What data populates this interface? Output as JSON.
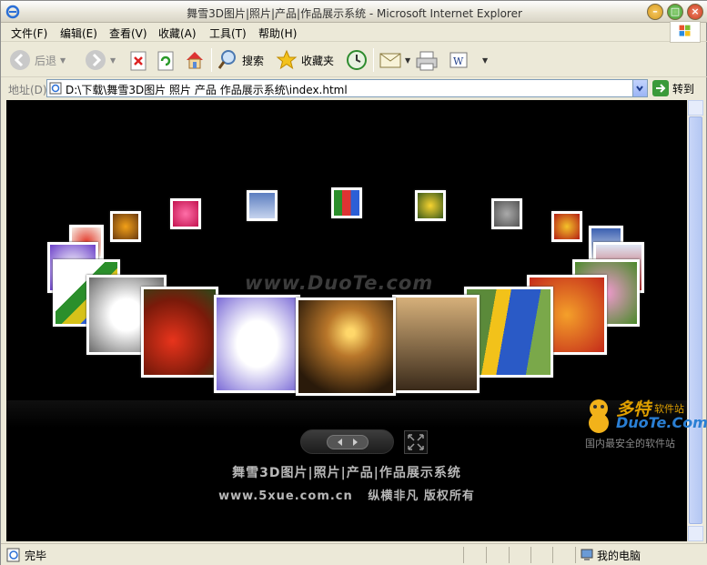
{
  "window": {
    "title": "舞雪3D图片|照片|产品|作品展示系统 - Microsoft Internet Explorer"
  },
  "menu": [
    "文件(F)",
    "编辑(E)",
    "查看(V)",
    "收藏(A)",
    "工具(T)",
    "帮助(H)"
  ],
  "toolbar": {
    "back": "后退",
    "search": "搜索",
    "favorites": "收藏夹"
  },
  "address": {
    "label": "地址(D)",
    "url": "D:\\下载\\舞雪3D图片 照片 产品 作品展示系统\\index.html",
    "go": "转到"
  },
  "page": {
    "watermark": "www.DuoTe.com",
    "footer_title": "舞雪3D图片|照片|产品|作品展示系统",
    "footer_url": "www.5xue.com.cn",
    "footer_copy": "纵横非凡  版权所有",
    "logo_name": "多特",
    "logo_suffix": "软件站",
    "logo_domain": "DuoTe.Com",
    "logo_slogan": "国内最安全的软件站"
  },
  "photos": [
    {
      "name": "photo-pink-heart",
      "subject": "pink heart"
    },
    {
      "name": "photo-winter-scene",
      "subject": "blue winter"
    },
    {
      "name": "photo-gift-cubes",
      "subject": "gift cubes"
    },
    {
      "name": "photo-sunflower-small",
      "subject": "sunflower"
    },
    {
      "name": "photo-parrot-small",
      "subject": "parrot"
    },
    {
      "name": "photo-strawberries",
      "subject": "strawberries"
    },
    {
      "name": "photo-yellow-flower",
      "subject": "yellow flower"
    },
    {
      "name": "photo-red-flower-right",
      "subject": "red flower"
    },
    {
      "name": "photo-house",
      "subject": "house"
    },
    {
      "name": "photo-purple-flower",
      "subject": "purple flower"
    },
    {
      "name": "photo-orchid",
      "subject": "orchid"
    },
    {
      "name": "photo-cubes-left",
      "subject": "cubes"
    },
    {
      "name": "photo-daisy",
      "subject": "daisy"
    },
    {
      "name": "photo-fruit",
      "subject": "fruit"
    },
    {
      "name": "photo-tomatoes",
      "subject": "tomatoes"
    },
    {
      "name": "photo-macaw",
      "subject": "macaw"
    },
    {
      "name": "photo-snowman",
      "subject": "snowman"
    },
    {
      "name": "photo-mantis",
      "subject": "mantis"
    },
    {
      "name": "photo-sunset",
      "subject": "sunset"
    }
  ],
  "status": {
    "text": "完毕",
    "zone": "我的电脑"
  },
  "colors": {
    "accent": "#0a246a",
    "content_bg": "#000000",
    "chrome": "#ece9d8"
  }
}
